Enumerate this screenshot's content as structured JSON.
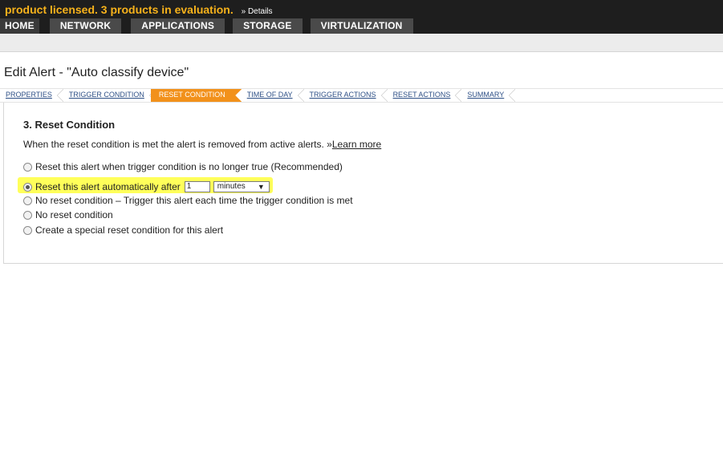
{
  "banner": {
    "license_text": "product licensed.  3 products in evaluation.",
    "details_link": "» Details"
  },
  "nav": {
    "tabs": [
      "HOME",
      "NETWORK",
      "APPLICATIONS",
      "STORAGE",
      "VIRTUALIZATION"
    ]
  },
  "page": {
    "title": "Edit Alert - \"Auto classify device\""
  },
  "wizard": {
    "steps": [
      "PROPERTIES",
      "TRIGGER CONDITION",
      "RESET CONDITION",
      "TIME OF DAY",
      "TRIGGER ACTIONS",
      "RESET ACTIONS",
      "SUMMARY"
    ],
    "active_step": "RESET CONDITION"
  },
  "section": {
    "title": "3. Reset Condition",
    "description": "When the reset condition is met the alert is removed from active alerts. »",
    "learn_more": "Learn more",
    "options": [
      {
        "label": "Reset this alert when trigger condition is no longer true (Recommended)",
        "selected": false
      },
      {
        "label": "Reset this alert automatically after",
        "selected": true
      },
      {
        "label": "No reset condition – Trigger this alert each time the trigger condition is met",
        "selected": false
      },
      {
        "label": "No reset condition",
        "selected": false
      },
      {
        "label": "Create a special reset condition for this alert",
        "selected": false
      }
    ],
    "auto_reset_value": "1",
    "auto_reset_unit": "minutes",
    "highlight_color": "#ffff5a"
  },
  "colors": {
    "accent": "#f2911b",
    "license_text": "#f7b21b",
    "topbar": "#1e1e1e",
    "link": "#2d4f86"
  }
}
